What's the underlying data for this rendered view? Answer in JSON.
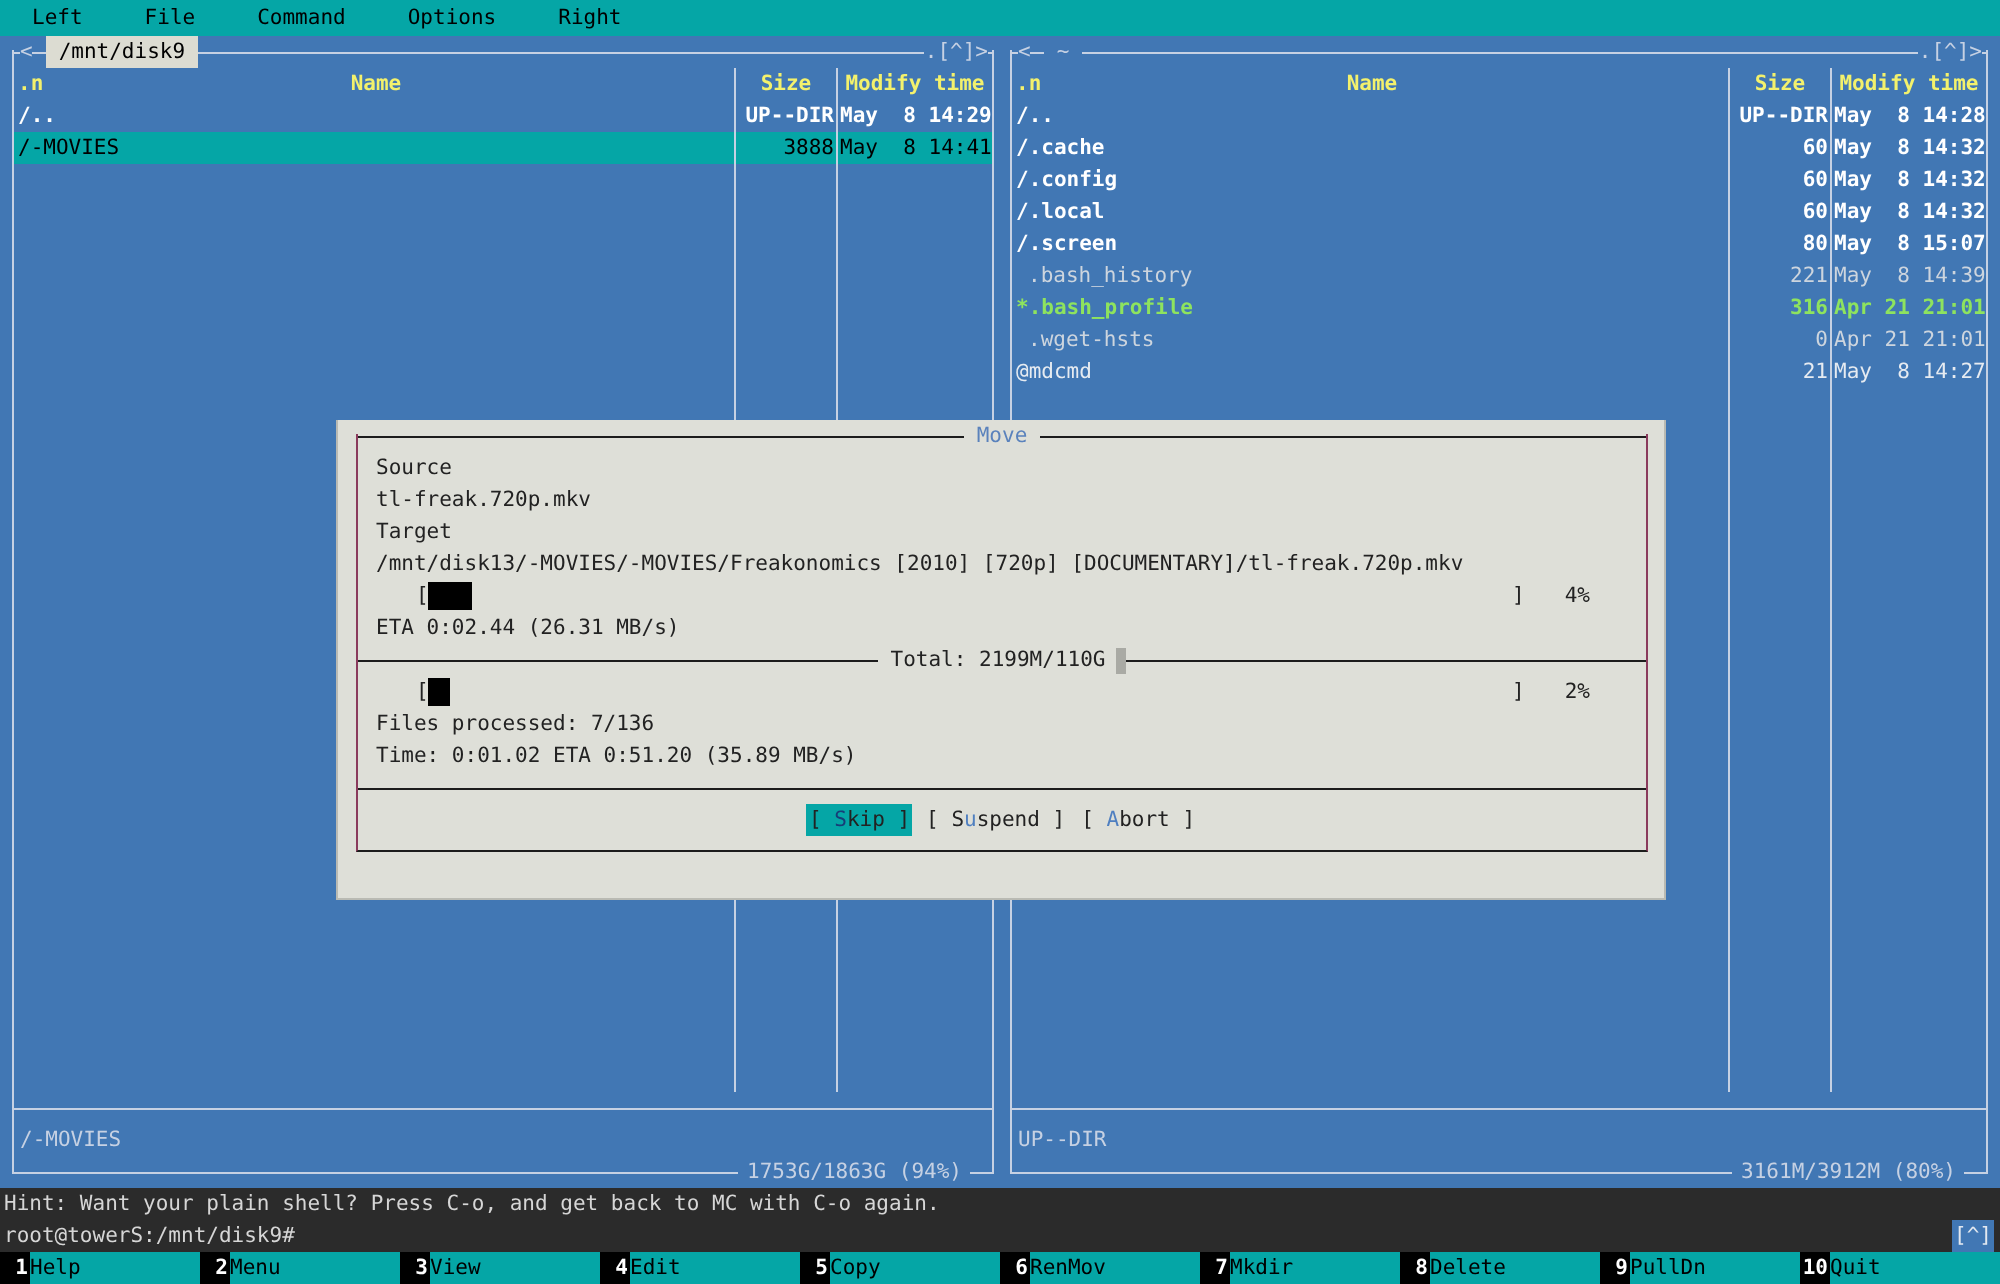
{
  "menu_bar": [
    "Left",
    "File",
    "Command",
    "Options",
    "Right"
  ],
  "panels": [
    {
      "active": true,
      "back": "<",
      "path": "/mnt/disk9",
      "controls": ".[^]>",
      "columns": [
        {
          "label": "Name",
          "sort_mark": ".n"
        },
        {
          "label": "Size"
        },
        {
          "label": "Modify time"
        }
      ],
      "files": [
        {
          "name": "/..",
          "size": "UP--DIR",
          "time": "May  8 14:29",
          "kind": "updir",
          "selected": false
        },
        {
          "name": "/-MOVIES",
          "size": "3888",
          "time": "May  8 14:41",
          "kind": "dir",
          "selected": true
        }
      ],
      "mini_status": "/-MOVIES",
      "disk_info": "1753G/1863G (94%)"
    },
    {
      "active": false,
      "back": "<",
      "path": "~",
      "controls": ".[^]>",
      "columns": [
        {
          "label": "Name",
          "sort_mark": ".n"
        },
        {
          "label": "Size"
        },
        {
          "label": "Modify time"
        }
      ],
      "files": [
        {
          "name": "/..",
          "size": "UP--DIR",
          "time": "May  8 14:28",
          "kind": "updir",
          "selected": false
        },
        {
          "name": "/.cache",
          "size": "60",
          "time": "May  8 14:32",
          "kind": "dir",
          "selected": false
        },
        {
          "name": "/.config",
          "size": "60",
          "time": "May  8 14:32",
          "kind": "dir",
          "selected": false
        },
        {
          "name": "/.local",
          "size": "60",
          "time": "May  8 14:32",
          "kind": "dir",
          "selected": false
        },
        {
          "name": "/.screen",
          "size": "80",
          "time": "May  8 15:07",
          "kind": "dir",
          "selected": false
        },
        {
          "name": ".bash_history",
          "size": "221",
          "time": "May  8 14:39",
          "kind": "file",
          "selected": false
        },
        {
          "name": "*.bash_profile",
          "size": "316",
          "time": "Apr 21 21:01",
          "kind": "exec",
          "selected": false
        },
        {
          "name": ".wget-hsts",
          "size": "0",
          "time": "Apr 21 21:01",
          "kind": "file",
          "selected": false
        },
        {
          "name": "@mdcmd",
          "size": "21",
          "time": "May  8 14:27",
          "kind": "link",
          "selected": false
        }
      ],
      "mini_status": "UP--DIR",
      "disk_info": "3161M/3912M (80%)"
    }
  ],
  "dialog": {
    "title": "Move",
    "source_label": "Source",
    "source": "tl-freak.720p.mkv",
    "target_label": "Target",
    "target": "/mnt/disk13/-MOVIES/-MOVIES/Freakonomics [2010] [720p] [DOCUMENTARY]/tl-freak.720p.mkv",
    "file_progress": {
      "open": "[",
      "close": "]",
      "level": 0.04,
      "percent": "4%"
    },
    "file_eta": "ETA 0:02.44 (26.31 MB/s)",
    "total": "Total: 2199M/110G",
    "total_progress": {
      "open": "[",
      "close": "]",
      "level": 0.02,
      "percent": "2%"
    },
    "files_processed": "Files processed: 7/136",
    "time": "Time: 0:01.02 ETA 0:51.20 (35.89 MB/s)",
    "buttons": [
      {
        "selected": true,
        "parts": [
          {
            "text": "[ ",
            "kind": "plain"
          },
          {
            "text": "S",
            "kind": "hotkey"
          },
          {
            "text": "kip ]",
            "kind": "plain"
          }
        ]
      },
      {
        "selected": false,
        "parts": [
          {
            "text": "[ S",
            "kind": "plain"
          },
          {
            "text": "u",
            "kind": "hotkey"
          },
          {
            "text": "spend ]",
            "kind": "plain"
          }
        ]
      },
      {
        "selected": false,
        "parts": [
          {
            "text": "[ ",
            "kind": "plain"
          },
          {
            "text": "A",
            "kind": "hotkey"
          },
          {
            "text": "bort ]",
            "kind": "plain"
          }
        ]
      }
    ]
  },
  "hint": "Hint: Want your plain shell? Press C-o, and get back to MC with C-o again.",
  "prompt": "root@towerS:/mnt/disk9#",
  "prompt_control": "[^]",
  "function_keys": [
    {
      "key": "1",
      "label": "Help"
    },
    {
      "key": "2",
      "label": "Menu"
    },
    {
      "key": "3",
      "label": "View"
    },
    {
      "key": "4",
      "label": "Edit"
    },
    {
      "key": "5",
      "label": "Copy"
    },
    {
      "key": "6",
      "label": "RenMov"
    },
    {
      "key": "7",
      "label": "Mkdir"
    },
    {
      "key": "8",
      "label": "Delete"
    },
    {
      "key": "9",
      "label": "PullDn"
    },
    {
      "key": "10",
      "label": "Quit"
    }
  ]
}
